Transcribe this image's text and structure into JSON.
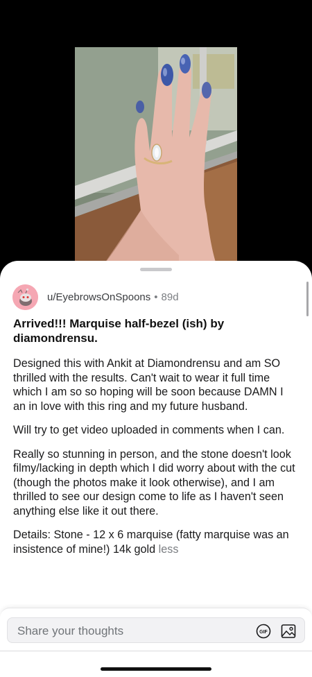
{
  "post": {
    "author": "u/EyebrowsOnSpoons",
    "separator": "•",
    "age": "89d",
    "title": "Arrived!!! Marquise half-bezel (ish) by diamondrensu.",
    "body": [
      "Designed this with Ankit at Diamondrensu and am SO thrilled with the results. Can't wait to wear it full time which I am so so hoping will be soon because DAMN I an in love with this ring and my future husband.",
      "Will try to get video uploaded in comments when I can.",
      "Really so stunning in person, and the stone doesn't look filmy/lacking in depth which I did worry about with the cut (though the photos make it look otherwise), and I am thrilled to see our design come to life as I haven't seen anything else like it out there.",
      "Details: Stone - 12 x 6 marquise (fatty marquise was an insistence of mine!) 14k gold"
    ],
    "less_label": "less"
  },
  "composer": {
    "placeholder": "Share your thoughts",
    "gif_icon": "gif-icon",
    "image_icon": "image-icon"
  },
  "colors": {
    "background": "#000000",
    "sheet": "#ffffff",
    "avatar": "#f5a7b3",
    "muted_text": "#7b7e82",
    "composer_bg": "#f2f2f4"
  }
}
